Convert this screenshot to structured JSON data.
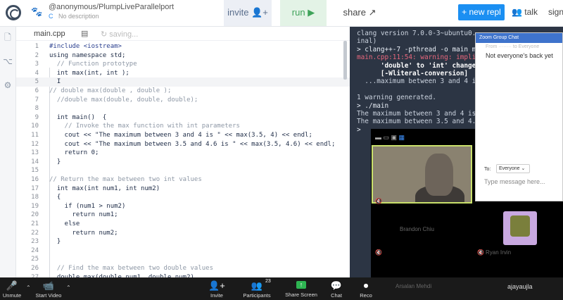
{
  "header": {
    "repo_title": "@anonymous/PlumpLiveParallelport",
    "repo_description": "No description",
    "invite_label": "invite",
    "run_label": "run",
    "share_label": "share",
    "new_repl_label": "+ new repl",
    "talk_label": "talk",
    "sign_label": "sign"
  },
  "editor": {
    "filename": "main.cpp",
    "save_status": "saving...",
    "lines": [
      {
        "n": "1",
        "text": "#include <iostream>"
      },
      {
        "n": "2",
        "text": "using namespace std;"
      },
      {
        "n": "3",
        "text": "  // Function prototype"
      },
      {
        "n": "4",
        "text": "  int max(int, int );"
      },
      {
        "n": "5",
        "text": "  I"
      },
      {
        "n": "6",
        "text": "// double max(double , double );"
      },
      {
        "n": "7",
        "text": "  //double max(double, double, double);"
      },
      {
        "n": "8",
        "text": ""
      },
      {
        "n": "9",
        "text": "  int main()  {"
      },
      {
        "n": "10",
        "text": "    // Invoke the max function with int parameters"
      },
      {
        "n": "11",
        "text": "    cout << \"The maximum between 3 and 4 is \" << max(3.5, 4) << endl;"
      },
      {
        "n": "12",
        "text": "    cout << \"The maximum between 3.5 and 4.6 is \" << max(3.5, 4.6) << endl;"
      },
      {
        "n": "13",
        "text": "    return 0;"
      },
      {
        "n": "14",
        "text": "  }"
      },
      {
        "n": "15",
        "text": ""
      },
      {
        "n": "16",
        "text": "// Return the max between two int values"
      },
      {
        "n": "17",
        "text": "  int max(int num1, int num2)"
      },
      {
        "n": "18",
        "text": "  {"
      },
      {
        "n": "19",
        "text": "    if (num1 > num2)"
      },
      {
        "n": "20",
        "text": "      return num1;"
      },
      {
        "n": "21",
        "text": "    else"
      },
      {
        "n": "22",
        "text": "      return num2;"
      },
      {
        "n": "23",
        "text": "  }"
      },
      {
        "n": "24",
        "text": ""
      },
      {
        "n": "25",
        "text": ""
      },
      {
        "n": "26",
        "text": "  // Find the max between two double values"
      },
      {
        "n": "27",
        "text": "  double max(double num1, double num2)"
      }
    ]
  },
  "console": {
    "lines": [
      {
        "text": "clang version 7.0.0-3~ubuntu0.",
        "cls": ""
      },
      {
        "text": "inal)",
        "cls": ""
      },
      {
        "text": "> clang++-7 -pthread -o main m",
        "cls": "prompt"
      },
      {
        "text": "main.cpp:11:54: warning: implic",
        "cls": "warn"
      },
      {
        "text": "      'double' to 'int' change",
        "cls": "bold"
      },
      {
        "text": "      [-Wliteral-conversion]",
        "cls": "bold"
      },
      {
        "text": "  ...maximum between 3 and 4 is",
        "cls": ""
      },
      {
        "text": "",
        "cls": ""
      },
      {
        "text": "1 warning generated.",
        "cls": ""
      },
      {
        "text": "> ./main",
        "cls": "prompt"
      },
      {
        "text": "The maximum between 3 and 4 is",
        "cls": ""
      },
      {
        "text": "The maximum between 3.5 and 4.6",
        "cls": ""
      },
      {
        "text": "> ",
        "cls": "prompt"
      }
    ]
  },
  "zoom": {
    "chat_title": "Zoom Group Chat",
    "chat_from": "From ········ to Everyone",
    "chat_message": "Not everyone's back yet",
    "chat_to_label": "To:",
    "chat_to_value": "Everyone",
    "chat_placeholder": "Type message here...",
    "tile_names": [
      "Brandon Chiu",
      "Ryan Irvin",
      "Arsalan Mehdi",
      "ajayaujla"
    ],
    "toolbar": {
      "unmute": "Unmute",
      "start_video": "Start Video",
      "invite": "Invite",
      "participants": "Participants",
      "participants_count": "23",
      "share_screen": "Share Screen",
      "chat": "Chat",
      "record": "Reco"
    }
  }
}
